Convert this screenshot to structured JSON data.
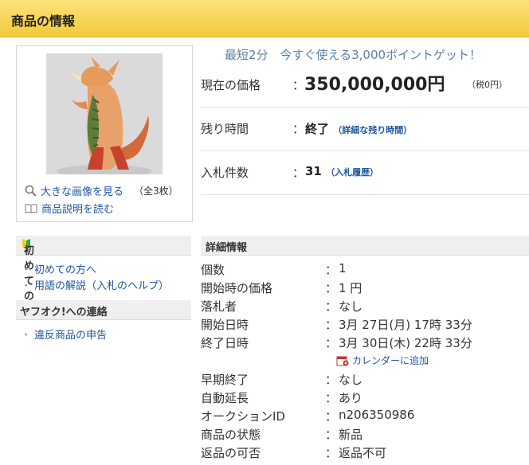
{
  "header": {
    "title": "商品の情報"
  },
  "thumbnail": {
    "view_large_label": "大きな画像を見る",
    "image_count": "（全3枚）",
    "read_description_label": "商品説明を読む"
  },
  "promo": {
    "text": "最短2分　今すぐ使える3,000ポイントゲット！"
  },
  "summary": {
    "current_price_label": "現在の価格",
    "current_price": "350,000,000円",
    "tax_note": "（税0円）",
    "time_left_label": "残り時間",
    "time_left_value": "終了",
    "time_left_link": "（詳細な残り時間）",
    "bids_label": "入札件数",
    "bids_value": "31",
    "bids_link": "（入札履歴）",
    "colon": "："
  },
  "sidebar": {
    "first_time_title": "初めての方",
    "first_time_links": [
      "初めての方へ",
      "用語の解説（入札のヘルプ）"
    ],
    "contact_title": "ヤフオク!への連絡",
    "contact_links": [
      "違反商品の申告"
    ]
  },
  "details": {
    "title": "詳細情報",
    "colon": "：",
    "rows": [
      {
        "key": "個数",
        "value": "1"
      },
      {
        "key": "開始時の価格",
        "value": "1 円"
      },
      {
        "key": "落札者",
        "value": "なし"
      },
      {
        "key": "開始日時",
        "value": "3月 27日(月) 17時 33分"
      },
      {
        "key": "終了日時",
        "value": "3月 30日(木) 22時 33分"
      },
      {
        "key": "早期終了",
        "value": "なし"
      },
      {
        "key": "自動延長",
        "value": "あり"
      },
      {
        "key": "オークションID",
        "value": "n206350986"
      },
      {
        "key": "商品の状態",
        "value": "新品"
      },
      {
        "key": "返品の可否",
        "value": "返品不可"
      }
    ],
    "calendar_link": "カレンダーに追加"
  }
}
